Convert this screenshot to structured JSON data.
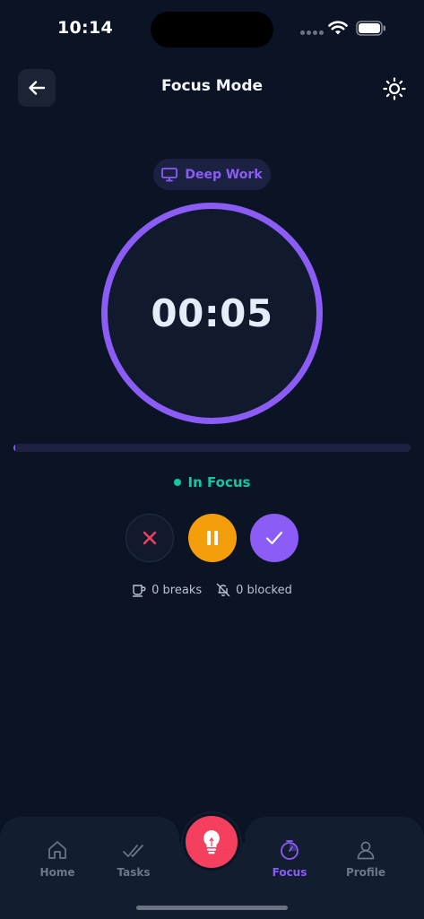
{
  "status_bar": {
    "time": "10:14"
  },
  "header": {
    "title": "Focus Mode",
    "back_icon": "arrow-left-icon",
    "theme_icon": "sun-icon"
  },
  "mode": {
    "label": "Deep Work",
    "icon": "monitor-icon"
  },
  "timer": {
    "value": "00:05",
    "progress": 0.004,
    "ring_color": "#8b5cf6"
  },
  "focus_status": {
    "label": "In Focus",
    "color": "#10c9a0"
  },
  "controls": {
    "cancel_icon": "close-icon",
    "pause_icon": "pause-icon",
    "complete_icon": "check-icon",
    "pause_color": "#f59e0b",
    "complete_color": "#8b5cf6",
    "cancel_color": "#f43f5e"
  },
  "stats": {
    "breaks": "0 breaks",
    "blocked": "0 blocked"
  },
  "nav": {
    "items": [
      {
        "label": "Home",
        "icon": "home-icon",
        "active": false
      },
      {
        "label": "Tasks",
        "icon": "checks-icon",
        "active": false
      },
      {
        "label": "Focus",
        "icon": "timer-icon",
        "active": true
      },
      {
        "label": "Profile",
        "icon": "user-icon",
        "active": false
      }
    ],
    "fab_icon": "lightbulb-icon",
    "fab_color": "#f43f5e"
  }
}
